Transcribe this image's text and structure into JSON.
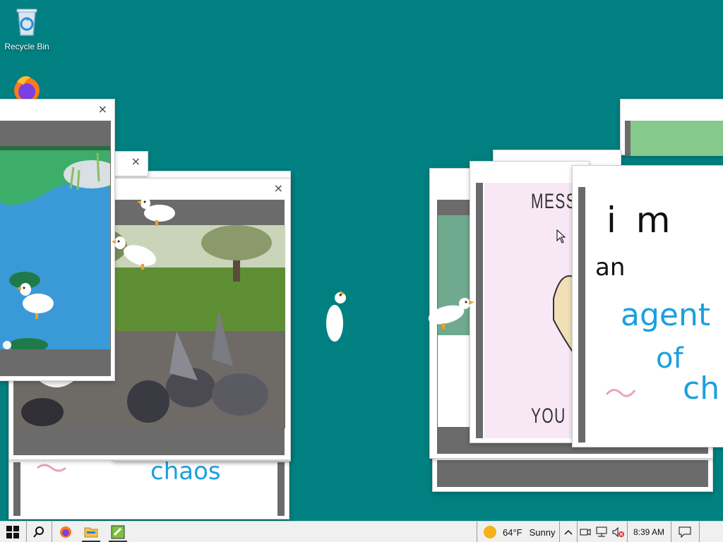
{
  "desktop": {
    "icons": [
      {
        "label": "Recycle Bin",
        "icon": "recycle-bin-icon"
      },
      {
        "label": "",
        "icon": "firefox-icon"
      }
    ]
  },
  "windows": {
    "close_glyph": "×",
    "drawing_text": {
      "line1": "i m",
      "line2": "an",
      "line3": "agent",
      "line4": "of",
      "line5": "ch",
      "bottom_word": "chaos"
    },
    "meme_text": {
      "top": "MESS",
      "bottom": "YOU"
    }
  },
  "taskbar": {
    "apps": [
      "start-icon",
      "search-icon",
      "firefox-icon",
      "file-explorer-icon",
      "app-icon"
    ],
    "weather": {
      "temp": "64°F",
      "condition": "Sunny"
    },
    "time": "8:39 AM"
  }
}
